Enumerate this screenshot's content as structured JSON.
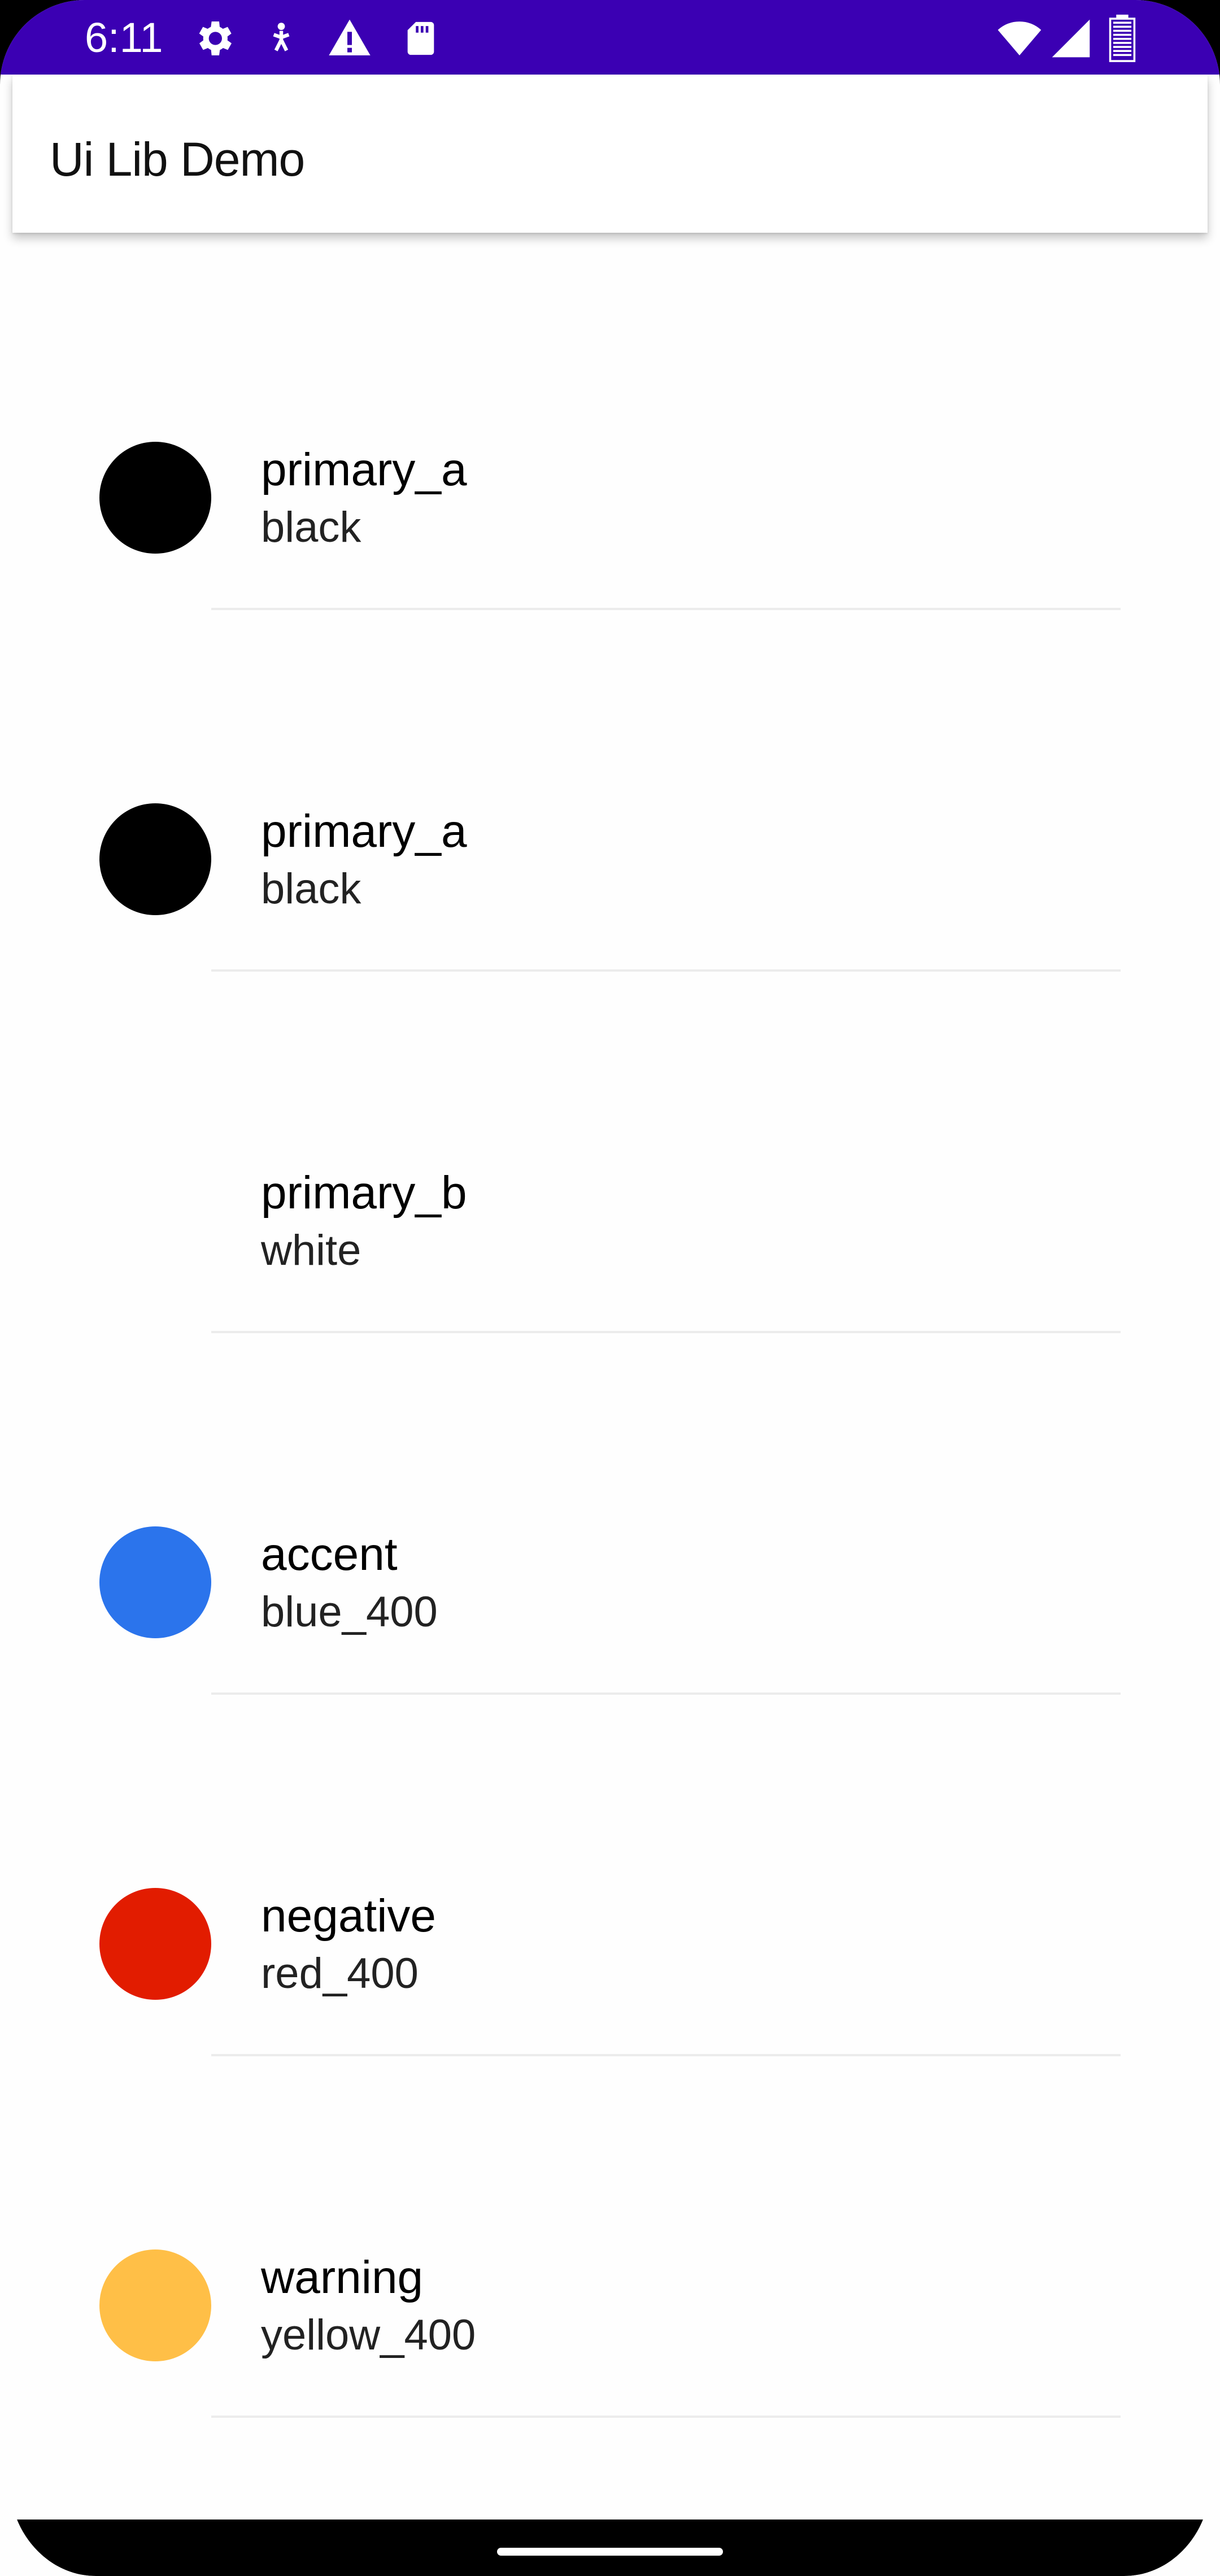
{
  "status_bar": {
    "time": "6:11",
    "background": "#3b00b3",
    "left_icons": [
      "settings-gear-icon",
      "accessibility-icon",
      "warning-icon",
      "sd-card-icon"
    ],
    "right_icons": [
      "wifi-icon",
      "cellular-signal-icon",
      "battery-icon"
    ]
  },
  "appbar": {
    "title": "Ui Lib Demo"
  },
  "colors": [
    {
      "name": "primary_a",
      "value": "black",
      "swatch": "#000000",
      "show_swatch": true
    },
    {
      "name": "primary_a",
      "value": "black",
      "swatch": "#000000",
      "show_swatch": true
    },
    {
      "name": "primary_b",
      "value": "white",
      "swatch": "#ffffff",
      "show_swatch": false
    },
    {
      "name": "accent",
      "value": "blue_400",
      "swatch": "#2b74ec",
      "show_swatch": true
    },
    {
      "name": "negative",
      "value": "red_400",
      "swatch": "#e21c00",
      "show_swatch": true
    },
    {
      "name": "warning",
      "value": "yellow_400",
      "swatch": "#ffbf47",
      "show_swatch": true
    }
  ]
}
